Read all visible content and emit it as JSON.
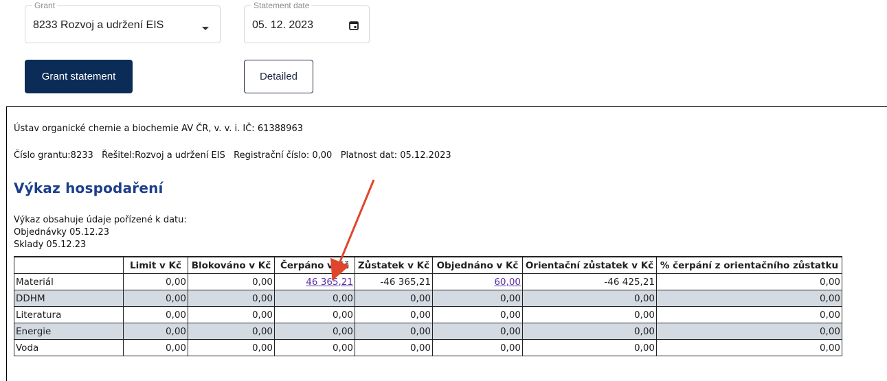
{
  "form": {
    "grant": {
      "legend": "Grant",
      "value": "8233 Rozvoj a udržení EIS"
    },
    "statement_date": {
      "legend": "Statement date",
      "value": "05. 12. 2023"
    },
    "grant_statement_button": "Grant statement",
    "detailed_button": "Detailed"
  },
  "report": {
    "institution_line": "Ústav organické chemie a biochemie AV ČR, v. v. i. IČ: 61388963",
    "grant_info_line": "Číslo grantu:8233   Řešitel:Rozvoj a udržení EIS   Registrační číslo: 0,00   Platnost dat: 05.12.2023",
    "title": "Výkaz hospodaření",
    "note_line1": "Výkaz obsahuje údaje pořízené k datu:",
    "note_line2": "Objednávky 05.12.23",
    "note_line3": "Sklady 05.12.23",
    "table": {
      "headers": [
        "",
        "Limit v Kč",
        "Blokováno v Kč",
        "Čerpáno v Kč",
        "Zůstatek v Kč",
        "Objednáno v Kč",
        "Orientační zůstatek v Kč",
        "% čerpání z orientačního zůstatku"
      ],
      "rows": [
        [
          "Materiál",
          "0,00",
          "0,00",
          "46 365,21",
          "-46 365,21",
          "60,00",
          "-46 425,21",
          "0,00"
        ],
        [
          "DDHM",
          "0,00",
          "0,00",
          "0,00",
          "0,00",
          "0,00",
          "0,00",
          "0,00"
        ],
        [
          "Literatura",
          "0,00",
          "0,00",
          "0,00",
          "0,00",
          "0,00",
          "0,00",
          "0,00"
        ],
        [
          "Energie",
          "0,00",
          "0,00",
          "0,00",
          "0,00",
          "0,00",
          "0,00",
          "0,00"
        ],
        [
          "Voda",
          "0,00",
          "0,00",
          "0,00",
          "0,00",
          "0,00",
          "0,00",
          "0,00"
        ]
      ]
    }
  },
  "icons": {
    "dropdown": "chevron-down-icon",
    "calendar": "calendar-icon",
    "annotation": "red-arrow-annotation"
  },
  "colors": {
    "primary": "#0b2c57",
    "title": "#1c3f8a",
    "link": "#5a2fa0",
    "row_alt": "#d4dae1",
    "arrow": "#e0462c"
  }
}
